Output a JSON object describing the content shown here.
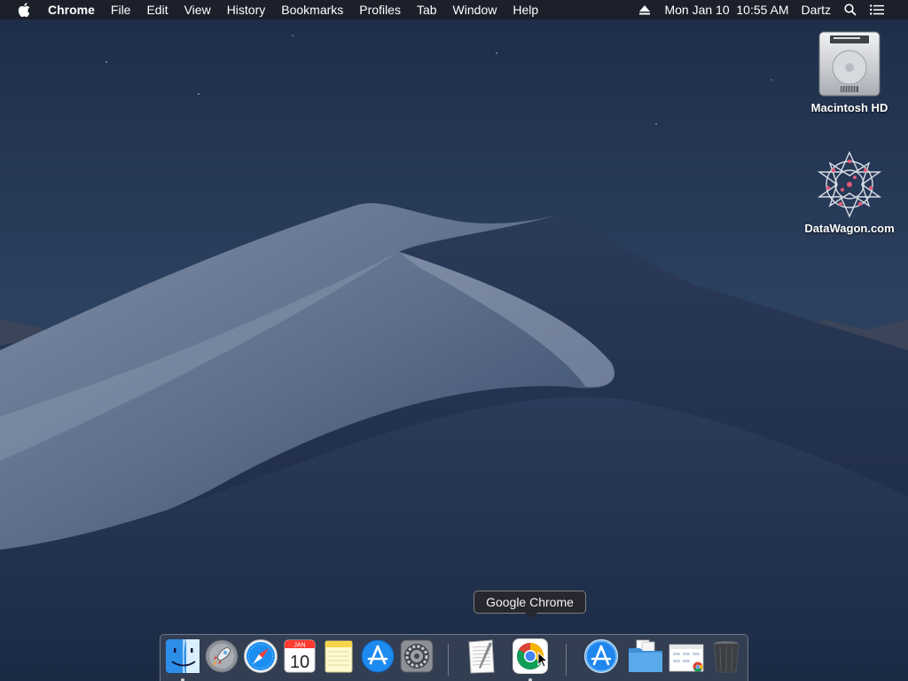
{
  "menubar": {
    "apple_icon": "apple-logo-icon",
    "app_name": "Chrome",
    "items": [
      "File",
      "Edit",
      "View",
      "History",
      "Bookmarks",
      "Profiles",
      "Tab",
      "Window",
      "Help"
    ],
    "eject_icon": "eject-icon",
    "datetime": "Mon Jan 10  10:55 AM",
    "user": "Dartz",
    "search_icon": "spotlight-search-icon",
    "notification_icon": "notification-center-icon"
  },
  "desktop": {
    "icons": [
      {
        "label": "Macintosh HD",
        "icon": "hard-drive-icon"
      },
      {
        "label": "DataWagon.com",
        "icon": "network-volume-icon"
      }
    ]
  },
  "tooltip": {
    "text": "Google Chrome"
  },
  "dock": {
    "calendar_month": "JAN",
    "calendar_day": "10",
    "items": [
      {
        "name": "Finder",
        "icon": "finder-icon",
        "running": true
      },
      {
        "name": "Launchpad",
        "icon": "launchpad-icon",
        "running": false
      },
      {
        "name": "Safari",
        "icon": "safari-icon",
        "running": false
      },
      {
        "name": "Calendar",
        "icon": "calendar-icon",
        "running": false
      },
      {
        "name": "Notes",
        "icon": "notes-icon",
        "running": false
      },
      {
        "name": "App Store",
        "icon": "app-store-icon",
        "running": false
      },
      {
        "name": "System Preferences",
        "icon": "system-preferences-icon",
        "running": false
      },
      {
        "name": "TextEdit",
        "icon": "textedit-icon",
        "running": false
      },
      {
        "name": "Google Chrome",
        "icon": "chrome-icon",
        "running": true
      },
      {
        "name": "Applications",
        "icon": "applications-folder-icon",
        "running": false
      },
      {
        "name": "Documents",
        "icon": "documents-folder-icon",
        "running": false
      },
      {
        "name": "Downloads",
        "icon": "downloads-stack-icon",
        "running": false
      },
      {
        "name": "Trash",
        "icon": "trash-icon",
        "running": false
      }
    ]
  }
}
